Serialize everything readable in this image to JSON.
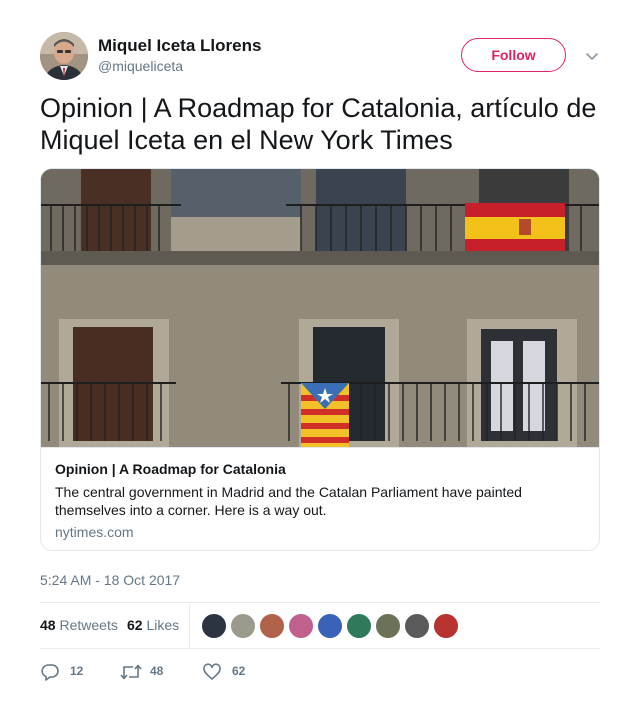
{
  "author": {
    "name": "Miquel Iceta Llorens",
    "handle": "@miqueliceta",
    "follow_label": "Follow"
  },
  "tweet": {
    "text": "Opinion | A Roadmap for Catalonia, artículo de Miquel Iceta en el New York Times",
    "timestamp": "5:24 AM - 18 Oct 2017"
  },
  "card": {
    "title": "Opinion | A Roadmap for Catalonia",
    "description": "The central government in Madrid and the Catalan Parliament have painted themselves into a corner. Here is a way out.",
    "domain": "nytimes.com"
  },
  "stats": {
    "retweets_count": "48",
    "retweets_label": "Retweets",
    "likes_count": "62",
    "likes_label": "Likes",
    "liker_avatar_count": 9
  },
  "actions": {
    "replies": "12",
    "retweets": "48",
    "likes": "62"
  },
  "colors": {
    "follow_accent": "#e0245e",
    "muted_text": "#657786",
    "primary_text": "#14171a",
    "border": "#e1e8ed"
  },
  "icons": [
    "chevron-down-icon",
    "reply-icon",
    "retweet-icon",
    "heart-icon"
  ]
}
